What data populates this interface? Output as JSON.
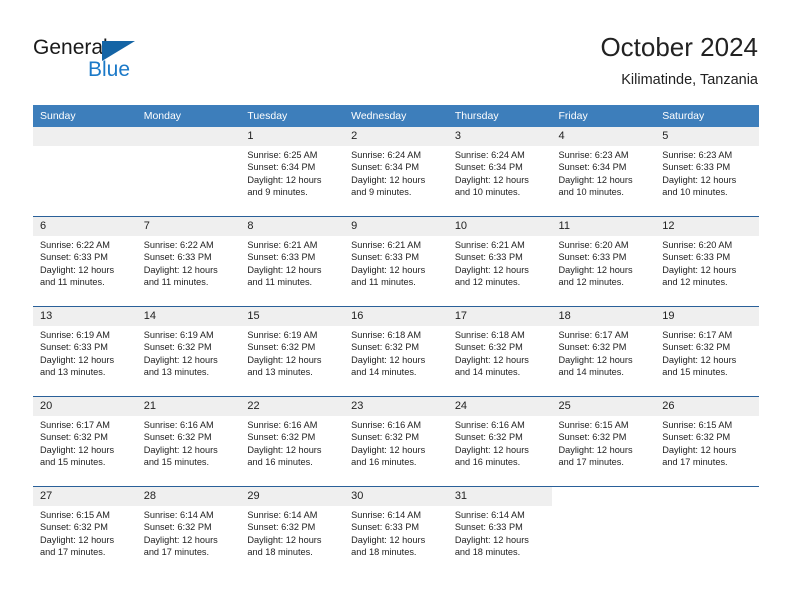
{
  "brand": {
    "name_part1": "General",
    "name_part2": "Blue",
    "triangle_color": "#1464a5",
    "blue_color": "#1b79c8"
  },
  "header": {
    "title": "October 2024",
    "subtitle": "Kilimatinde, Tanzania"
  },
  "colors": {
    "header_blue": "#3d7ebb",
    "row_divider": "#2a6099",
    "daynum_band": "#efefef",
    "text": "#222222"
  },
  "weekdays": [
    "Sunday",
    "Monday",
    "Tuesday",
    "Wednesday",
    "Thursday",
    "Friday",
    "Saturday"
  ],
  "labels": {
    "sunrise_prefix": "Sunrise:",
    "sunset_prefix": "Sunset:",
    "daylight_prefix": "Daylight:"
  },
  "weeks": [
    [
      {
        "day": "",
        "blank": true
      },
      {
        "day": "",
        "blank": true
      },
      {
        "day": "1",
        "sunrise": "Sunrise: 6:25 AM",
        "sunset": "Sunset: 6:34 PM",
        "daylight1": "Daylight: 12 hours",
        "daylight2": "and 9 minutes."
      },
      {
        "day": "2",
        "sunrise": "Sunrise: 6:24 AM",
        "sunset": "Sunset: 6:34 PM",
        "daylight1": "Daylight: 12 hours",
        "daylight2": "and 9 minutes."
      },
      {
        "day": "3",
        "sunrise": "Sunrise: 6:24 AM",
        "sunset": "Sunset: 6:34 PM",
        "daylight1": "Daylight: 12 hours",
        "daylight2": "and 10 minutes."
      },
      {
        "day": "4",
        "sunrise": "Sunrise: 6:23 AM",
        "sunset": "Sunset: 6:34 PM",
        "daylight1": "Daylight: 12 hours",
        "daylight2": "and 10 minutes."
      },
      {
        "day": "5",
        "sunrise": "Sunrise: 6:23 AM",
        "sunset": "Sunset: 6:33 PM",
        "daylight1": "Daylight: 12 hours",
        "daylight2": "and 10 minutes."
      }
    ],
    [
      {
        "day": "6",
        "sunrise": "Sunrise: 6:22 AM",
        "sunset": "Sunset: 6:33 PM",
        "daylight1": "Daylight: 12 hours",
        "daylight2": "and 11 minutes."
      },
      {
        "day": "7",
        "sunrise": "Sunrise: 6:22 AM",
        "sunset": "Sunset: 6:33 PM",
        "daylight1": "Daylight: 12 hours",
        "daylight2": "and 11 minutes."
      },
      {
        "day": "8",
        "sunrise": "Sunrise: 6:21 AM",
        "sunset": "Sunset: 6:33 PM",
        "daylight1": "Daylight: 12 hours",
        "daylight2": "and 11 minutes."
      },
      {
        "day": "9",
        "sunrise": "Sunrise: 6:21 AM",
        "sunset": "Sunset: 6:33 PM",
        "daylight1": "Daylight: 12 hours",
        "daylight2": "and 11 minutes."
      },
      {
        "day": "10",
        "sunrise": "Sunrise: 6:21 AM",
        "sunset": "Sunset: 6:33 PM",
        "daylight1": "Daylight: 12 hours",
        "daylight2": "and 12 minutes."
      },
      {
        "day": "11",
        "sunrise": "Sunrise: 6:20 AM",
        "sunset": "Sunset: 6:33 PM",
        "daylight1": "Daylight: 12 hours",
        "daylight2": "and 12 minutes."
      },
      {
        "day": "12",
        "sunrise": "Sunrise: 6:20 AM",
        "sunset": "Sunset: 6:33 PM",
        "daylight1": "Daylight: 12 hours",
        "daylight2": "and 12 minutes."
      }
    ],
    [
      {
        "day": "13",
        "sunrise": "Sunrise: 6:19 AM",
        "sunset": "Sunset: 6:33 PM",
        "daylight1": "Daylight: 12 hours",
        "daylight2": "and 13 minutes."
      },
      {
        "day": "14",
        "sunrise": "Sunrise: 6:19 AM",
        "sunset": "Sunset: 6:32 PM",
        "daylight1": "Daylight: 12 hours",
        "daylight2": "and 13 minutes."
      },
      {
        "day": "15",
        "sunrise": "Sunrise: 6:19 AM",
        "sunset": "Sunset: 6:32 PM",
        "daylight1": "Daylight: 12 hours",
        "daylight2": "and 13 minutes."
      },
      {
        "day": "16",
        "sunrise": "Sunrise: 6:18 AM",
        "sunset": "Sunset: 6:32 PM",
        "daylight1": "Daylight: 12 hours",
        "daylight2": "and 14 minutes."
      },
      {
        "day": "17",
        "sunrise": "Sunrise: 6:18 AM",
        "sunset": "Sunset: 6:32 PM",
        "daylight1": "Daylight: 12 hours",
        "daylight2": "and 14 minutes."
      },
      {
        "day": "18",
        "sunrise": "Sunrise: 6:17 AM",
        "sunset": "Sunset: 6:32 PM",
        "daylight1": "Daylight: 12 hours",
        "daylight2": "and 14 minutes."
      },
      {
        "day": "19",
        "sunrise": "Sunrise: 6:17 AM",
        "sunset": "Sunset: 6:32 PM",
        "daylight1": "Daylight: 12 hours",
        "daylight2": "and 15 minutes."
      }
    ],
    [
      {
        "day": "20",
        "sunrise": "Sunrise: 6:17 AM",
        "sunset": "Sunset: 6:32 PM",
        "daylight1": "Daylight: 12 hours",
        "daylight2": "and 15 minutes."
      },
      {
        "day": "21",
        "sunrise": "Sunrise: 6:16 AM",
        "sunset": "Sunset: 6:32 PM",
        "daylight1": "Daylight: 12 hours",
        "daylight2": "and 15 minutes."
      },
      {
        "day": "22",
        "sunrise": "Sunrise: 6:16 AM",
        "sunset": "Sunset: 6:32 PM",
        "daylight1": "Daylight: 12 hours",
        "daylight2": "and 16 minutes."
      },
      {
        "day": "23",
        "sunrise": "Sunrise: 6:16 AM",
        "sunset": "Sunset: 6:32 PM",
        "daylight1": "Daylight: 12 hours",
        "daylight2": "and 16 minutes."
      },
      {
        "day": "24",
        "sunrise": "Sunrise: 6:16 AM",
        "sunset": "Sunset: 6:32 PM",
        "daylight1": "Daylight: 12 hours",
        "daylight2": "and 16 minutes."
      },
      {
        "day": "25",
        "sunrise": "Sunrise: 6:15 AM",
        "sunset": "Sunset: 6:32 PM",
        "daylight1": "Daylight: 12 hours",
        "daylight2": "and 17 minutes."
      },
      {
        "day": "26",
        "sunrise": "Sunrise: 6:15 AM",
        "sunset": "Sunset: 6:32 PM",
        "daylight1": "Daylight: 12 hours",
        "daylight2": "and 17 minutes."
      }
    ],
    [
      {
        "day": "27",
        "sunrise": "Sunrise: 6:15 AM",
        "sunset": "Sunset: 6:32 PM",
        "daylight1": "Daylight: 12 hours",
        "daylight2": "and 17 minutes."
      },
      {
        "day": "28",
        "sunrise": "Sunrise: 6:14 AM",
        "sunset": "Sunset: 6:32 PM",
        "daylight1": "Daylight: 12 hours",
        "daylight2": "and 17 minutes."
      },
      {
        "day": "29",
        "sunrise": "Sunrise: 6:14 AM",
        "sunset": "Sunset: 6:32 PM",
        "daylight1": "Daylight: 12 hours",
        "daylight2": "and 18 minutes."
      },
      {
        "day": "30",
        "sunrise": "Sunrise: 6:14 AM",
        "sunset": "Sunset: 6:33 PM",
        "daylight1": "Daylight: 12 hours",
        "daylight2": "and 18 minutes."
      },
      {
        "day": "31",
        "sunrise": "Sunrise: 6:14 AM",
        "sunset": "Sunset: 6:33 PM",
        "daylight1": "Daylight: 12 hours",
        "daylight2": "and 18 minutes."
      },
      {
        "day": "",
        "nodate": true
      },
      {
        "day": "",
        "nodate": true
      }
    ]
  ]
}
